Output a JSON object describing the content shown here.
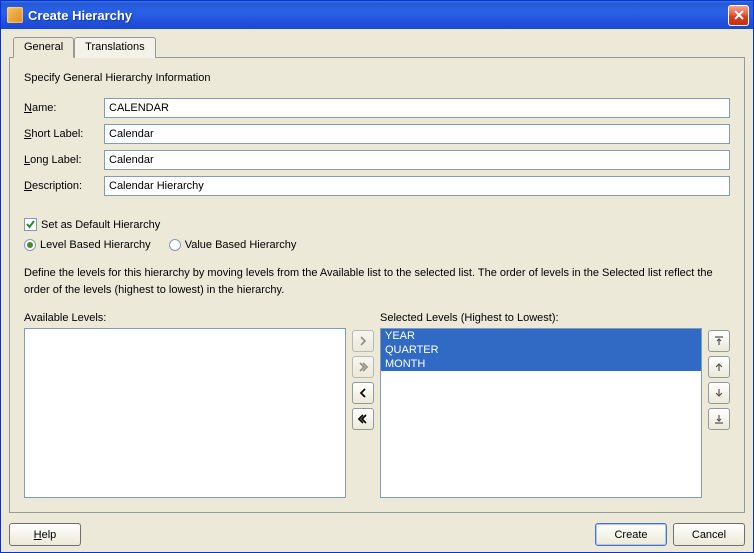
{
  "window": {
    "title": "Create Hierarchy"
  },
  "tabs": {
    "general": "General",
    "translations": "Translations"
  },
  "section_title": "Specify General Hierarchy Information",
  "labels": {
    "name": "Name:",
    "short_label": "Short Label:",
    "long_label": "Long Label:",
    "description": "Description:"
  },
  "fields": {
    "name": "CALENDAR",
    "short_label": "Calendar",
    "long_label": "Calendar",
    "description": "Calendar Hierarchy"
  },
  "default_hierarchy": {
    "label": "Set as Default Hierarchy",
    "checked": true
  },
  "hierarchy_type": {
    "level_based": "Level Based Hierarchy",
    "value_based": "Value Based Hierarchy",
    "selected": "level"
  },
  "instruction": "Define the levels for this hierarchy by moving levels from the Available list to the selected list. The order of levels in the Selected list reflect the order of the levels (highest to lowest) in the hierarchy.",
  "lists": {
    "available_label": "Available Levels:",
    "selected_label": "Selected Levels (Highest to Lowest):",
    "available": [],
    "selected": [
      "YEAR",
      "QUARTER",
      "MONTH"
    ]
  },
  "buttons": {
    "help": "Help",
    "create": "Create",
    "cancel": "Cancel"
  }
}
